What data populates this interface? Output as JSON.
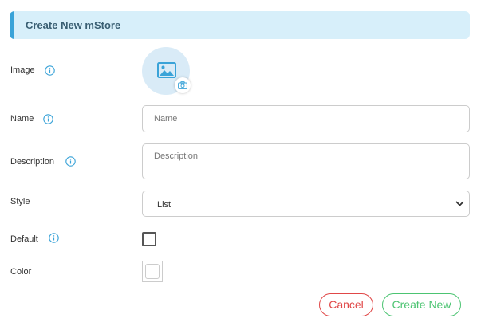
{
  "header": {
    "title": "Create New mStore"
  },
  "form": {
    "image": {
      "label": "Image",
      "info_icon": "info-circle-icon",
      "placeholder_icon": "image-icon",
      "upload_icon": "camera-icon"
    },
    "name": {
      "label": "Name",
      "info_icon": "info-circle-icon",
      "value": "",
      "placeholder": "Name"
    },
    "description": {
      "label": "Description",
      "info_icon": "info-circle-icon",
      "value": "",
      "placeholder": "Description"
    },
    "style": {
      "label": "Style",
      "selected": "List",
      "chevron_icon": "chevron-down-icon"
    },
    "default": {
      "label": "Default",
      "info_icon": "info-circle-icon",
      "checked": false
    },
    "color": {
      "label": "Color",
      "value": "#ffffff"
    }
  },
  "actions": {
    "cancel_label": "Cancel",
    "create_label": "Create New"
  },
  "colors": {
    "header_bg": "#d7effa",
    "header_accent": "#3aa3d8",
    "info_icon": "#3aa3d8",
    "cancel": "#e04747",
    "create": "#4cc472",
    "avatar_bg": "#d9ebf7"
  }
}
